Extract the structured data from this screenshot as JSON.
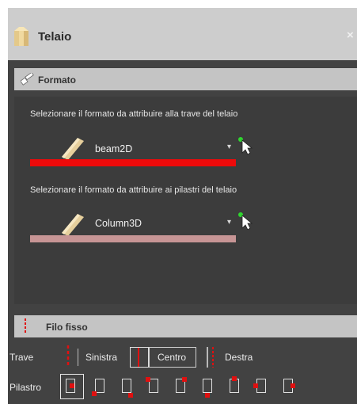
{
  "window": {
    "title": "Telaio",
    "close_glyph": "×"
  },
  "formato_section": {
    "title": "Formato",
    "beam_prompt": "Selezionare il formato da attribuire alla trave del telaio",
    "beam_format": "beam2D",
    "beam_color": "#ee0a0a",
    "column_prompt": "Selezionare il formato da attribuire ai pilastri del telaio",
    "column_format": "Column3D",
    "column_color": "#c79595"
  },
  "filo_section": {
    "title": "Filo fisso"
  },
  "trave_row": {
    "label": "Trave",
    "options": [
      "Sinistra",
      "Centro",
      "Destra"
    ],
    "selected": "Centro"
  },
  "pilastro_row": {
    "label": "Pilastro",
    "options_count_note": "9 anchor options, first selected"
  }
}
